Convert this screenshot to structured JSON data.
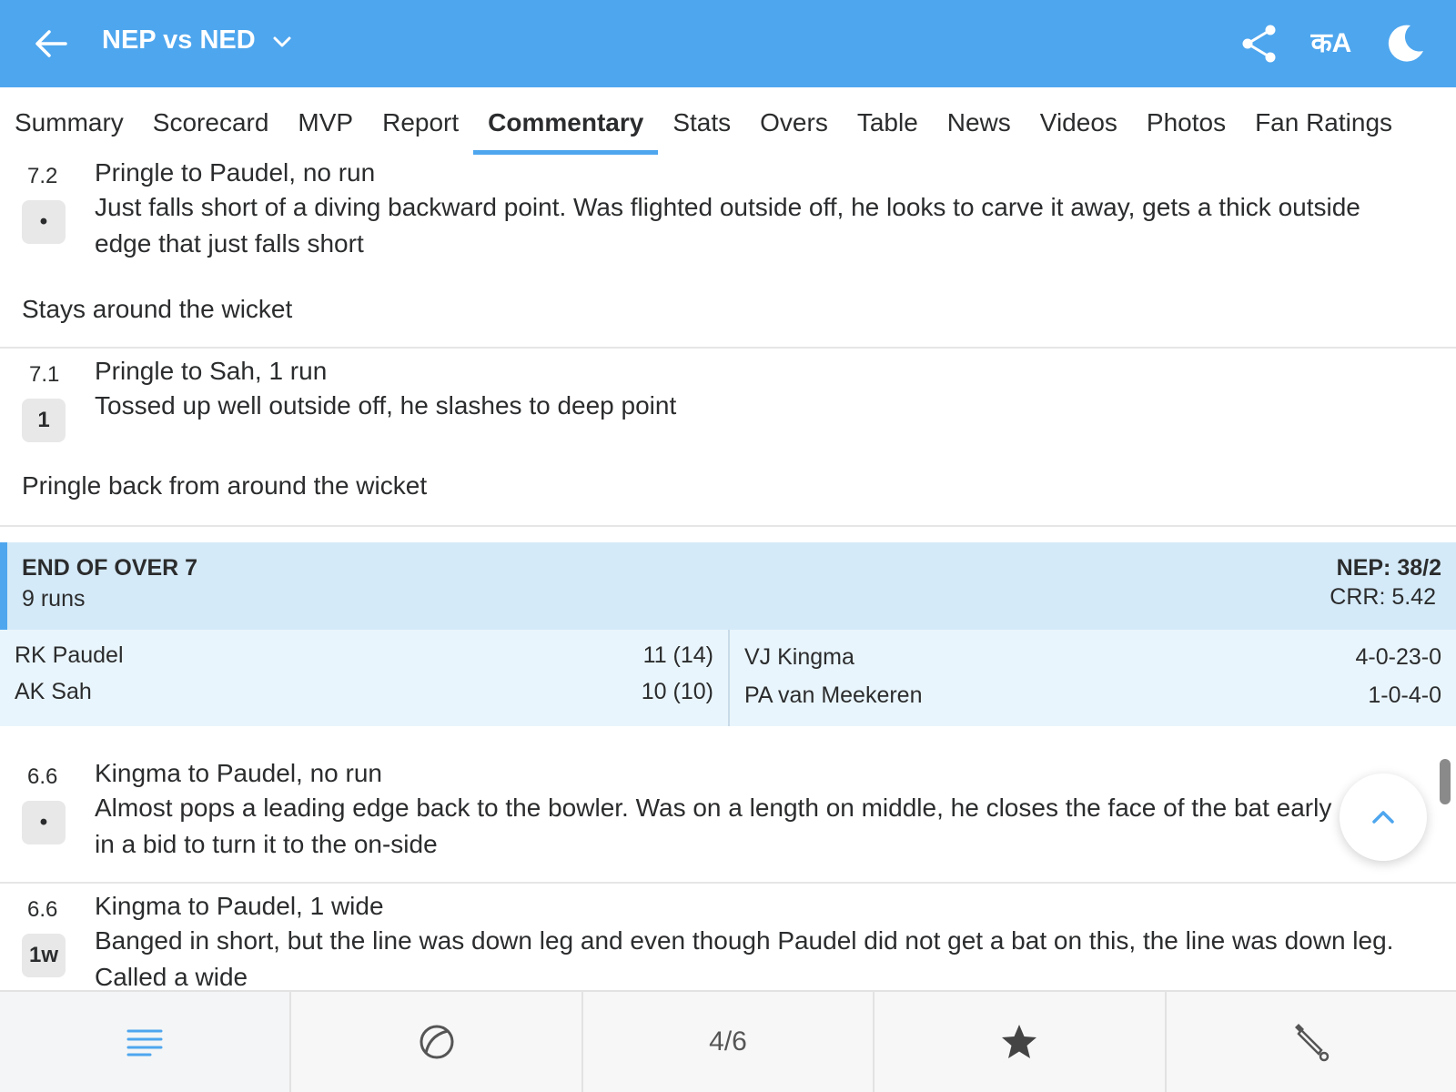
{
  "header": {
    "title": "NEP vs NED",
    "lang_label": "कA",
    "accent_color": "#4ea6ee",
    "icons": [
      "back-arrow-icon",
      "chevron-down-icon",
      "share-icon",
      "language-icon",
      "moon-icon"
    ]
  },
  "tabs": [
    {
      "label": "Summary"
    },
    {
      "label": "Scorecard"
    },
    {
      "label": "MVP"
    },
    {
      "label": "Report"
    },
    {
      "label": "Commentary",
      "active": true
    },
    {
      "label": "Stats"
    },
    {
      "label": "Overs"
    },
    {
      "label": "Table"
    },
    {
      "label": "News"
    },
    {
      "label": "Videos"
    },
    {
      "label": "Photos"
    },
    {
      "label": "Fan Ratings"
    }
  ],
  "commentary": {
    "b72": {
      "over": "7.2",
      "result": "•",
      "head": "Pringle to Paudel, no run",
      "text": "Just falls short of a diving backward point. Was flighted outside off, he looks to carve it away, gets a thick outside edge that just falls short"
    },
    "note1": "Stays around the wicket",
    "b71": {
      "over": "7.1",
      "result": "1",
      "head": "Pringle to Sah, 1 run",
      "text": "Tossed up well outside off, he slashes to deep point"
    },
    "note2": "Pringle back from around the wicket",
    "end_of_over": {
      "title": "END OF OVER 7",
      "runs": "9 runs",
      "score": "NEP: 38/2",
      "crr": "CRR: 5.42",
      "batters": [
        {
          "name": "RK Paudel",
          "score": "11 (14)"
        },
        {
          "name": "AK Sah",
          "score": "10 (10)"
        }
      ],
      "bowlers": [
        {
          "name": "VJ Kingma",
          "figures": "4-0-23-0"
        },
        {
          "name": "PA van Meekeren",
          "figures": "1-0-4-0"
        }
      ]
    },
    "b66a": {
      "over": "6.6",
      "result": "•",
      "head": "Kingma to Paudel, no run",
      "text": "Almost pops a leading edge back to the bowler. Was on a length on middle, he closes the face of the bat early in a bid to turn it to the on-side"
    },
    "b66b": {
      "over": "6.6",
      "result": "1w",
      "head": "Kingma to Paudel, 1 wide",
      "text": "Banged in short, but the line was down leg and even though Paudel did not get a bat on this, the line was down leg. Called a wide"
    }
  },
  "bottom_nav": {
    "page_indicator": "4/6",
    "icons": [
      "commentary-lines-icon",
      "ball-icon",
      "star-icon",
      "bat-icon"
    ]
  }
}
